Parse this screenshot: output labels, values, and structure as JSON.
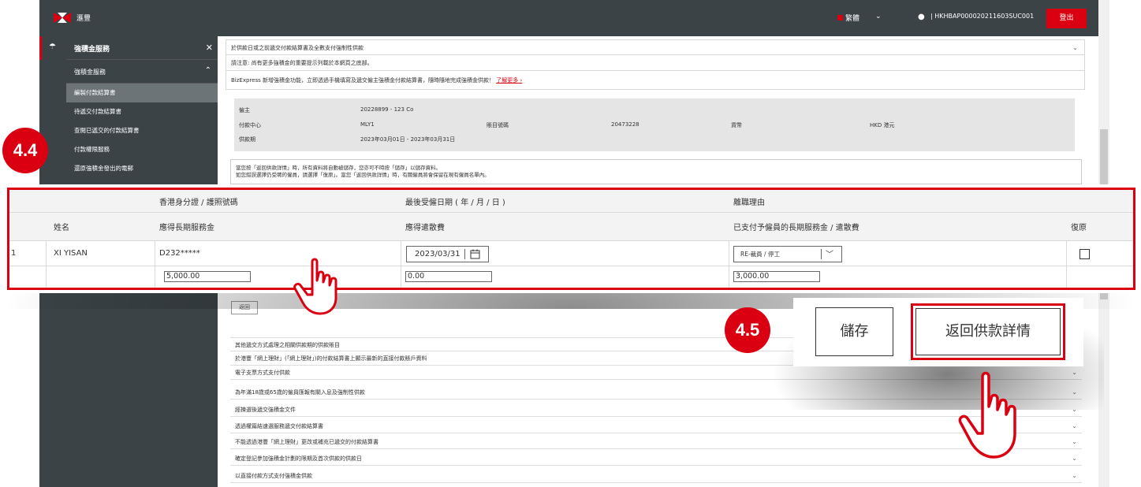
{
  "topbar": {
    "logo_text": "滙豐",
    "language": "繁體",
    "user_id": "HKHBAP000020211603SUC001",
    "logout_label": "登出"
  },
  "sidebar": {
    "header": "強積金服務",
    "subheader": "強積金服務",
    "items": [
      {
        "label": "編製付款結算書",
        "selected": true
      },
      {
        "label": "待遞交付款結算書",
        "selected": false
      },
      {
        "label": "查閱已遞交的付款結算書",
        "selected": false
      },
      {
        "label": "付款權限服務",
        "selected": false
      },
      {
        "label": "還原強積金發出的電郵",
        "selected": false
      }
    ]
  },
  "content": {
    "dropdown_row": "於供款日或之前遞交付款結算書及全數支付強制性供款",
    "reminder": "請注意: 尚有更多強積金的重要提示列載於本網頁之底部。",
    "bizexpress_text": "BizExpress 新增強積金功能，立即透過手機填寫及遞交僱主強積金付款結算書，隨時隨地完成強積金供款！",
    "bizexpress_link": "了解更多 ›",
    "summary": {
      "employer_label": "僱主",
      "employer_value": "20228899 - 123 Co",
      "center_label": "付款中心",
      "center_value": "MLY1",
      "account_label": "賬目號碼",
      "account_value": "20473228",
      "currency_label": "貨幣",
      "currency_value": "HKD 港元",
      "period_label": "供款期",
      "period_value": "2023年03月01日 - 2023年03月31日"
    },
    "notice_line1": "當您按「返回供款詳情」時，所有資料將自動被儲存，您亦可不時按「儲存」以儲存資料。",
    "notice_line2": "如您錯誤選擇仍受聘的僱員，請選擇「復原」。當您「返回供款詳情」時，有關僱員將會保留在現有僱員名單內。",
    "back_small_label": "返回",
    "faq_items": [
      "其他遞交方式處理之相關供款期的供款賬目",
      "於港豐「網上理財」(「網上理財」)的付款結算書上顯示最新的直接付款賬戶資料",
      "電子支票方式支付供款",
      "為年滿18歲或65歲的僱員匯報有關入息及強制性供款",
      "經揀選後遞交強積金文件",
      "透過權篇結速選服務遞交付款結算書",
      "不能透過港豐「網上理財」更改或補充已遞交的付款結算書",
      "確定登記參加強積金計劃的限期及首次供款的供款日",
      "以直接付款方式支付強積金供款"
    ]
  },
  "zoom_table": {
    "headers": {
      "col2_top": "香港身分證 / 護照號碼",
      "col3_top": "最後受僱日期 ( 年 / 月 / 日 )",
      "col4_top": "離職理由",
      "name": "姓名",
      "col2_bottom": "應得長期服務金",
      "col3_bottom": "應得遣散費",
      "col4_bottom": "已支付予僱員的長期服務金 / 遣散費",
      "restore": "復原"
    },
    "row": {
      "index": "1",
      "name": "XI YISAN",
      "id": "D232*****",
      "last_date": "2023/03/31",
      "reason": "RE-裁員 / 停工",
      "long_service": "5,000.00",
      "severance": "0.00",
      "paid": "3,000.00"
    }
  },
  "callouts": {
    "badge_44": "4.4",
    "badge_45": "4.5",
    "save_label": "儲存",
    "return_label": "返回供款詳情"
  },
  "colors": {
    "brand_red": "#db0011",
    "dark_nav": "#3b4347"
  }
}
